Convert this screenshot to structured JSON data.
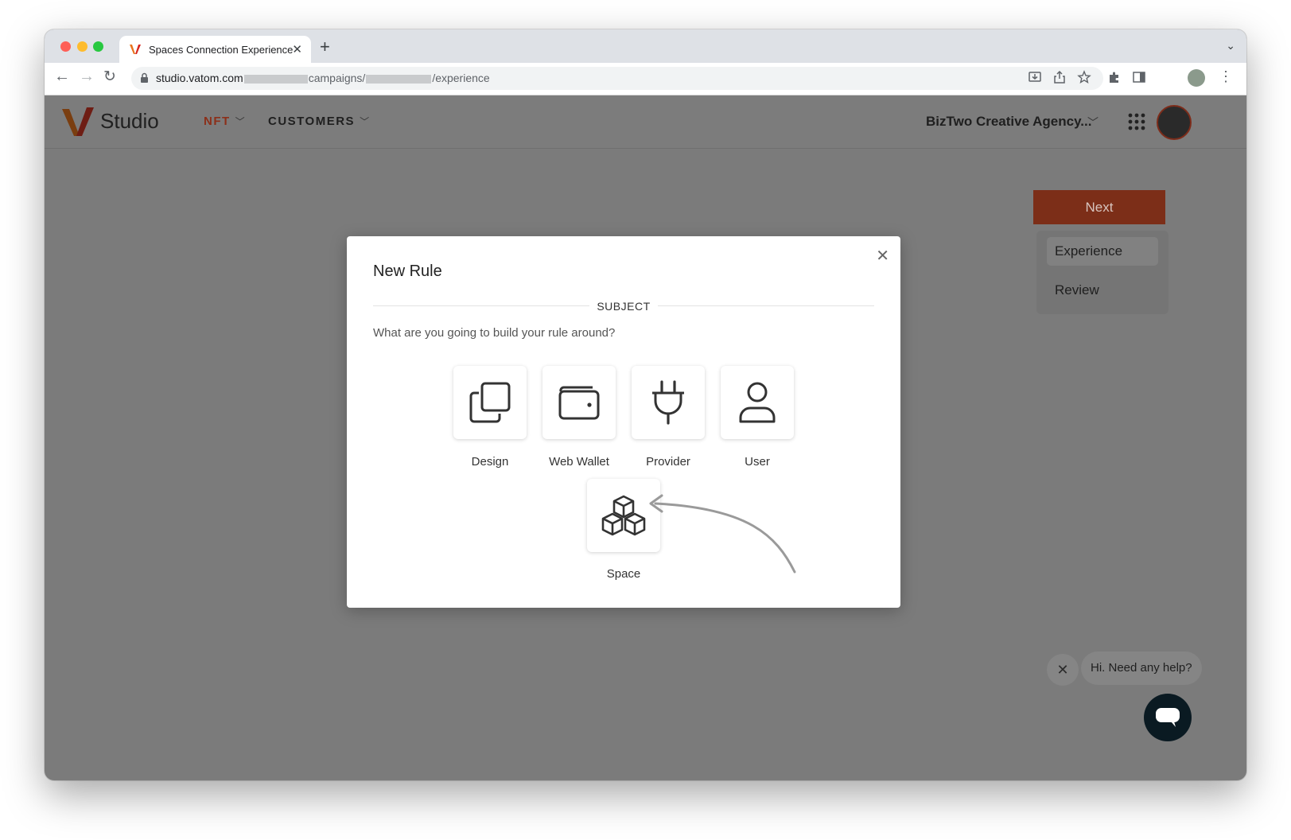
{
  "browser": {
    "tab_title": "Spaces Connection Experience",
    "url_host": "studio.vatom.com",
    "url_mid": "campaigns/",
    "url_tail": "/experience"
  },
  "header": {
    "logo_text": "Studio",
    "nav": [
      {
        "label": "NFT",
        "active": true
      },
      {
        "label": "CUSTOMERS",
        "active": false
      }
    ],
    "org_name": "BizTwo Creative Agency...",
    "accent_color": "#b13a1c"
  },
  "side_panel": {
    "next_label": "Next",
    "steps": [
      {
        "label": "Experience",
        "active": true
      },
      {
        "label": "Review",
        "active": false
      }
    ]
  },
  "modal": {
    "title": "New Rule",
    "section_label": "SUBJECT",
    "question": "What are you going to build your rule around?",
    "options": [
      {
        "label": "Design",
        "icon": "copy-icon"
      },
      {
        "label": "Web Wallet",
        "icon": "wallet-icon"
      },
      {
        "label": "Provider",
        "icon": "plug-icon"
      },
      {
        "label": "User",
        "icon": "user-icon"
      },
      {
        "label": "Space",
        "icon": "cubes-icon"
      }
    ]
  },
  "chat": {
    "prompt": "Hi. Need any help?"
  }
}
